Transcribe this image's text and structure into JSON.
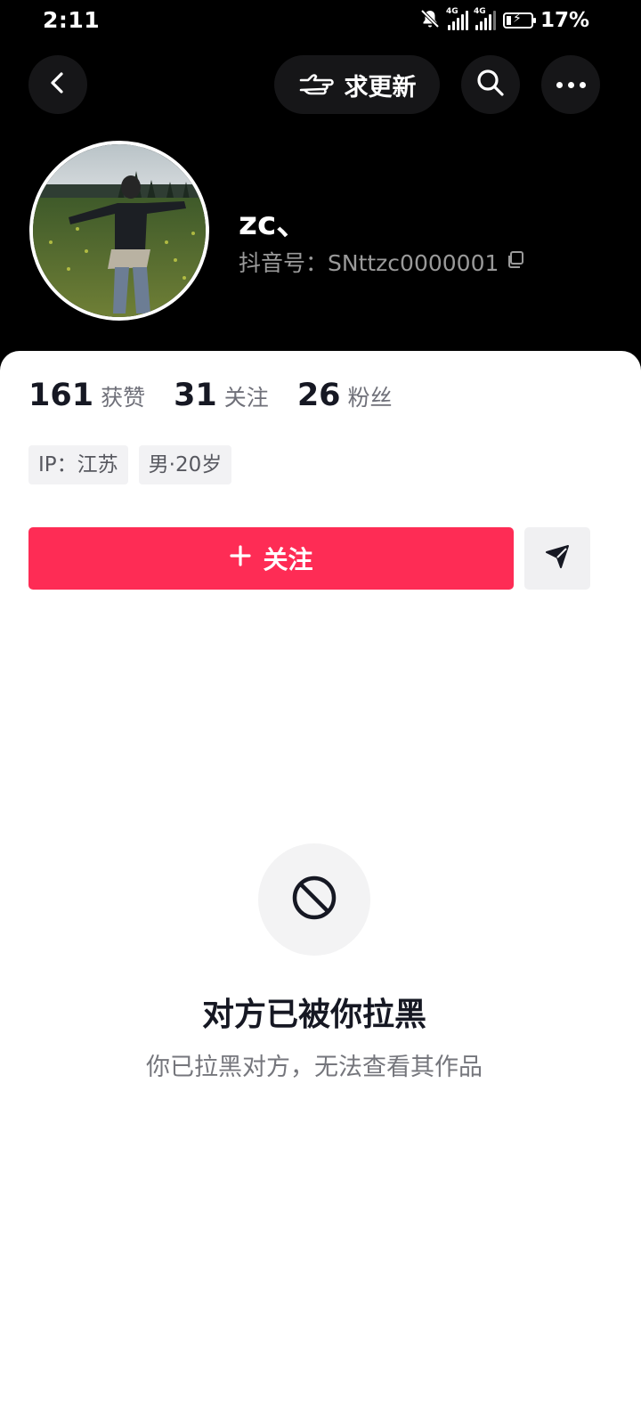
{
  "status_bar": {
    "time": "2:11",
    "network_1": "4G",
    "network_2": "4G",
    "battery": "17%"
  },
  "top_bar": {
    "back_icon": "chevron-left-icon",
    "request_update_label": "求更新",
    "request_update_icon": "pointing-hand-icon",
    "search_icon": "search-icon",
    "more_icon": "more-dots-icon"
  },
  "profile": {
    "username": "zc、",
    "douyin_id": "抖音号：SNttzc0000001",
    "copy_icon": "copy-icon"
  },
  "stats": [
    {
      "value": "161",
      "label": "获赞"
    },
    {
      "value": "31",
      "label": "关注"
    },
    {
      "value": "26",
      "label": "粉丝"
    }
  ],
  "tags": [
    "IP：江苏",
    "男·20岁"
  ],
  "actions": {
    "follow_label": "关注",
    "follow_icon": "plus-icon",
    "share_icon": "send-icon"
  },
  "blocked": {
    "icon": "block-icon",
    "title": "对方已被你拉黑",
    "description": "你已拉黑对方，无法查看其作品"
  },
  "colors": {
    "header_bg": "#000000",
    "accent": "#fe2c55",
    "text_primary": "#161823",
    "text_secondary": "#75767c"
  }
}
